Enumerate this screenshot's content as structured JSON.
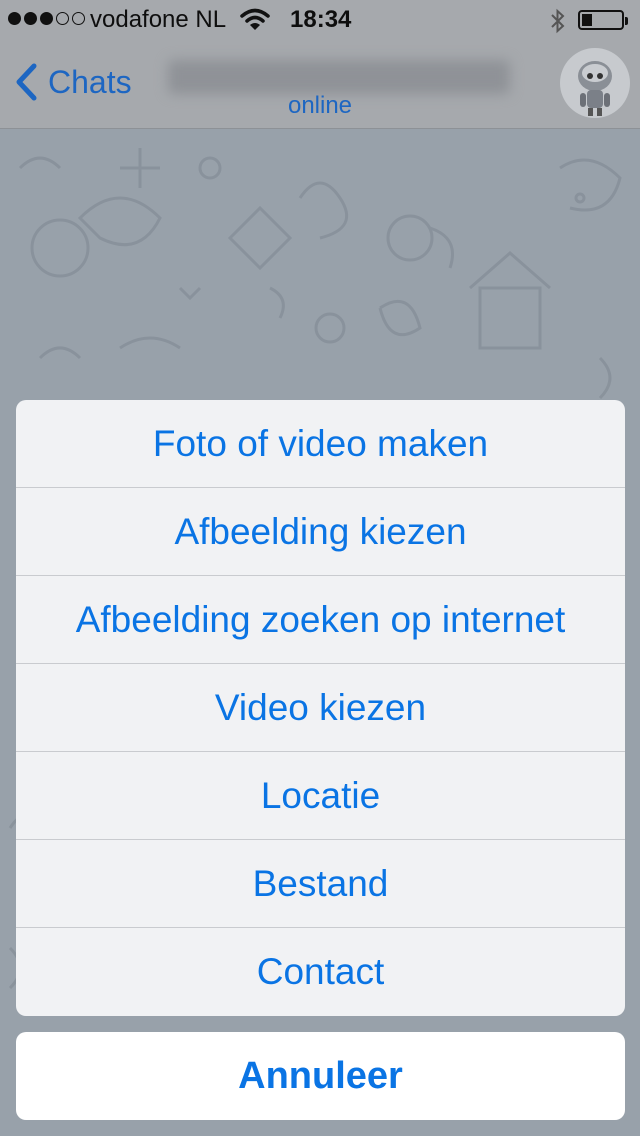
{
  "status_bar": {
    "carrier": "vodafone NL",
    "time": "18:34",
    "signal_bars": 3,
    "signal_total": 5,
    "battery_level": 0.25
  },
  "navbar": {
    "back_label": "Chats",
    "subtitle": "online"
  },
  "action_sheet": {
    "items": [
      {
        "label": "Foto of video maken"
      },
      {
        "label": "Afbeelding kiezen"
      },
      {
        "label": "Afbeelding zoeken op internet"
      },
      {
        "label": "Video kiezen"
      },
      {
        "label": "Locatie"
      },
      {
        "label": "Bestand"
      },
      {
        "label": "Contact"
      }
    ],
    "cancel_label": "Annuleer"
  },
  "colors": {
    "accent": "#0a74e4",
    "nav_accent": "#1d66c2"
  },
  "icons": [
    "chevron-left-icon",
    "wifi-icon",
    "bluetooth-icon",
    "battery-icon",
    "avatar-robot-icon"
  ]
}
